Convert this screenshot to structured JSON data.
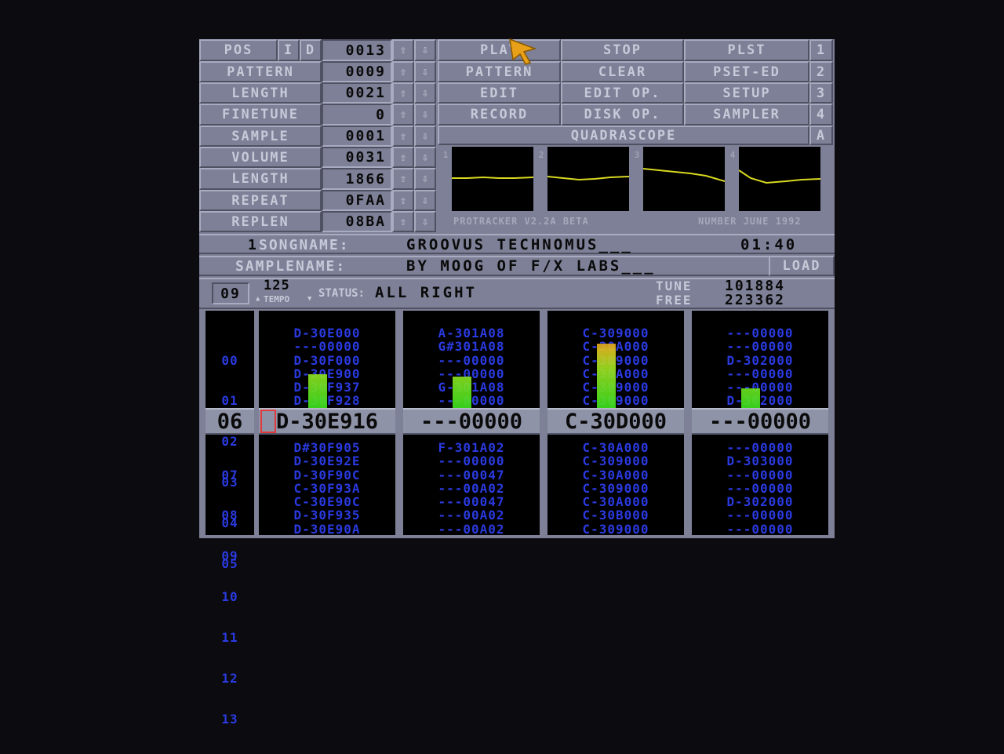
{
  "labels": {
    "pos": "POS",
    "i": "I",
    "d": "D",
    "pattern": "PATTERN",
    "length": "LENGTH",
    "finetune": "FINETUNE",
    "sample": "SAMPLE",
    "volume": "VOLUME",
    "length2": "LENGTH",
    "repeat": "REPEAT",
    "replen": "REPLEN"
  },
  "values": {
    "pos": "0013",
    "pattern": "0009",
    "length": "0021",
    "finetune": "0",
    "sample": "0001",
    "volume": "0031",
    "length2": "1866",
    "repeat": "0FAA",
    "replen": "08BA"
  },
  "arrows": {
    "up": "⇧",
    "down": "⇩"
  },
  "buttons": {
    "play": "PLAY",
    "stop": "STOP",
    "plst": "PLST",
    "n1": "1",
    "pattern": "PATTERN",
    "clear": "CLEAR",
    "pset_ed": "PSET-ED",
    "n2": "2",
    "edit": "EDIT",
    "edit_op": "EDIT OP.",
    "setup": "SETUP",
    "n3": "3",
    "record": "RECORD",
    "disk_op": "DISK OP.",
    "sampler": "SAMPLER",
    "n4": "4",
    "quadrascope": "QUADRASCOPE",
    "a": "A",
    "load": "LOAD"
  },
  "scope": {
    "channels": [
      "1",
      "2",
      "3",
      "4"
    ],
    "footer_left": "PROTRACKER V2.2A BETA",
    "footer_right": "NUMBER JUNE 1992",
    "trace_color": "#d8d820"
  },
  "song": {
    "index": "1",
    "label": "SONGNAME:",
    "name": "GROOVUS TECHNOMUS___",
    "time": "01:40"
  },
  "samplename": {
    "label": "SAMPLENAME:",
    "name": "BY MOOG OF F/X LABS___"
  },
  "status": {
    "pattern_num": "09",
    "tempo": "125",
    "tempo_label": "TEMPO",
    "status_label": "STATUS:",
    "status_text": "ALL RIGHT",
    "tune_label": "TUNE",
    "tune_value": "101884",
    "free_label": "FREE",
    "free_value": "223362"
  },
  "pattern_editor": {
    "row_numbers_above": [
      "00",
      "01",
      "02",
      "03",
      "04",
      "05"
    ],
    "row_numbers_below": [
      "07",
      "08",
      "09",
      "10",
      "11",
      "12",
      "13"
    ],
    "current_row": "06",
    "channels": [
      {
        "above": [
          "D-30E000",
          "---00000",
          "D-30F000",
          "D-30E900",
          "D-30F937",
          "D-30F928"
        ],
        "current": "D-30E916",
        "below": [
          "D#30F905",
          "D-30E92E",
          "D-30F90C",
          "C-30F93A",
          "C-30E90C",
          "D-30F935",
          "D-30E90A"
        ],
        "vu_level": 0.38
      },
      {
        "above": [
          "A-301A08",
          "G#301A08",
          "---00000",
          "---00000",
          "G-301A08",
          "---00000"
        ],
        "current": "---00000",
        "below": [
          "F-301A02",
          "---00000",
          "---00047",
          "---00A02",
          "---00047",
          "---00A02",
          "---00A02"
        ],
        "vu_level": 0.35
      },
      {
        "above": [
          "C-309000",
          "C-30A000",
          "C-309000",
          "C-30A000",
          "C-309000",
          "C-309000"
        ],
        "current": "C-30D000",
        "below": [
          "C-30A000",
          "C-309000",
          "C-30A000",
          "C-309000",
          "C-30A000",
          "C-30B000",
          "C-309000"
        ],
        "vu_level": 0.72
      },
      {
        "above": [
          "---00000",
          "---00000",
          "D-302000",
          "---00000",
          "---00000",
          "D-302000"
        ],
        "current": "---00000",
        "below": [
          "---00000",
          "D-303000",
          "---00000",
          "---00000",
          "D-302000",
          "---00000",
          "---00000"
        ],
        "vu_level": 0.22
      }
    ]
  },
  "colors": {
    "panel": "#7d8096",
    "pattern_text": "#2a3ae0",
    "vu_low": "#3ce01e",
    "vu_high": "#e02a10"
  }
}
